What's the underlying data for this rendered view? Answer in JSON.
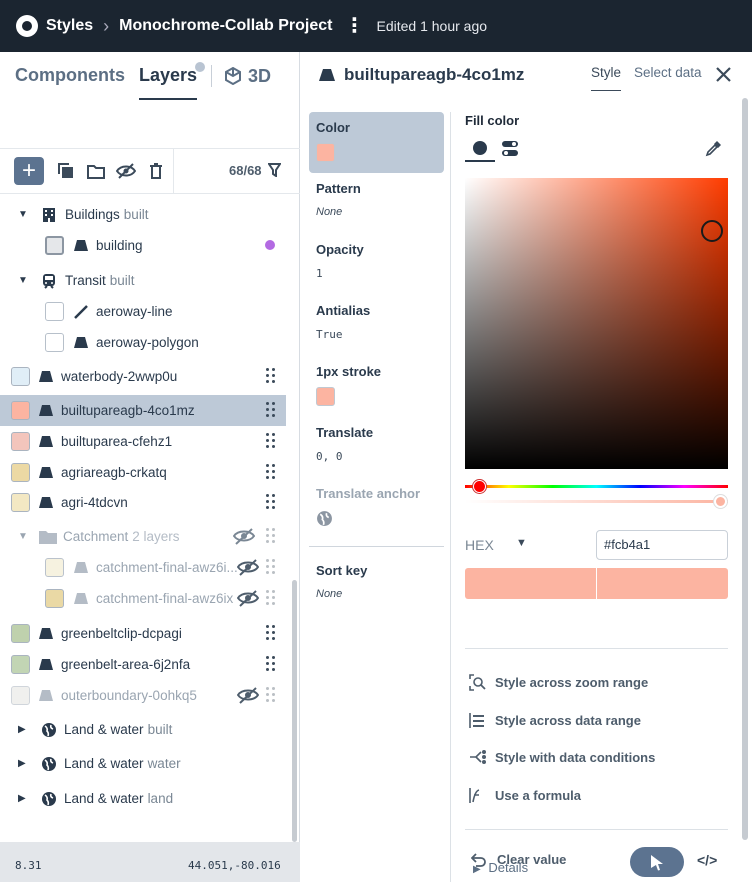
{
  "topbar": {
    "app": "Styles",
    "project": "Monochrome-Collab Project",
    "edited": "Edited 1 hour ago"
  },
  "left_panel": {
    "tabs": [
      {
        "label": "Components",
        "active": false
      },
      {
        "label": "Layers",
        "active": true
      },
      {
        "label": "3D",
        "active": false
      }
    ],
    "layer_count": "68/68",
    "layers": [
      {
        "kind": "group",
        "name": "Buildings",
        "sub": "built",
        "icon": "building-icon",
        "expanded": true
      },
      {
        "kind": "child",
        "name": "building",
        "swatch": "#e5e7ea",
        "indicator": "#b36ae2"
      },
      {
        "kind": "group",
        "name": "Transit",
        "sub": "built",
        "icon": "train-icon",
        "expanded": true
      },
      {
        "kind": "child",
        "name": "aeroway-line",
        "type": "line"
      },
      {
        "kind": "child",
        "name": "aeroway-polygon"
      },
      {
        "kind": "layer",
        "name": "waterbody-2wwp0u",
        "swatch": "#e0eef7"
      },
      {
        "kind": "layer",
        "name": "builtupareagb-4co1mz",
        "swatch": "#fcb4a1",
        "selected": true
      },
      {
        "kind": "layer",
        "name": "builtuparea-cfehz1",
        "swatch": "#f3c5bc"
      },
      {
        "kind": "layer",
        "name": "agriareagb-crkatq",
        "swatch": "#ecd9a4"
      },
      {
        "kind": "layer",
        "name": "agri-4tdcvn",
        "swatch": "#f3e8c3"
      },
      {
        "kind": "folder",
        "name": "Catchment",
        "sub": "2 layers",
        "hidden": true
      },
      {
        "kind": "folder-child",
        "name": "catchment-final-awz6i...",
        "swatch": "#f5efd9",
        "hidden": true
      },
      {
        "kind": "folder-child",
        "name": "catchment-final-awz6ix",
        "swatch": "#ead9a5",
        "hidden": true
      },
      {
        "kind": "layer",
        "name": "greenbeltclip-dcpagi",
        "swatch": "#bfd1ad"
      },
      {
        "kind": "layer",
        "name": "greenbelt-area-6j2nfa",
        "swatch": "#c2d5b4"
      },
      {
        "kind": "layer",
        "name": "outerboundary-0ohkq5",
        "swatch": "#f0f0ee",
        "hidden": true
      },
      {
        "kind": "collapsed",
        "name": "Land & water",
        "sub": "built"
      },
      {
        "kind": "collapsed",
        "name": "Land & water",
        "sub": "water"
      },
      {
        "kind": "collapsed",
        "name": "Land & water",
        "sub": "land"
      }
    ],
    "status": {
      "zoom": "8.31",
      "coords": "44.051,-80.016"
    }
  },
  "right_panel": {
    "title": "builtupareagb-4co1mz",
    "tabs": [
      {
        "label": "Style",
        "active": true
      },
      {
        "label": "Select data",
        "active": false
      }
    ],
    "properties": [
      {
        "label": "Color",
        "swatch": "#fcb4a1",
        "selected": true
      },
      {
        "label": "Pattern",
        "value": "None",
        "italic": true
      },
      {
        "label": "Opacity",
        "value": "1"
      },
      {
        "label": "Antialias",
        "value": "True"
      },
      {
        "label": "1px stroke",
        "swatch": "#fcb4a1"
      },
      {
        "label": "Translate",
        "value": "0, 0"
      },
      {
        "label": "Translate anchor",
        "muted": true
      },
      {
        "label": "Sort key",
        "value": "None",
        "italic": true
      }
    ],
    "editor": {
      "heading": "Fill color",
      "format": "HEX",
      "hex_value": "#fcb4a1",
      "color": "#fcb4a1",
      "actions": [
        {
          "label": "Style across zoom range",
          "icon": "zoom-range-icon"
        },
        {
          "label": "Style across data range",
          "icon": "data-range-icon"
        },
        {
          "label": "Style with data conditions",
          "icon": "data-conditions-icon"
        },
        {
          "label": "Use a formula",
          "icon": "formula-icon"
        }
      ],
      "clear": "Clear value",
      "details": "Details"
    }
  }
}
